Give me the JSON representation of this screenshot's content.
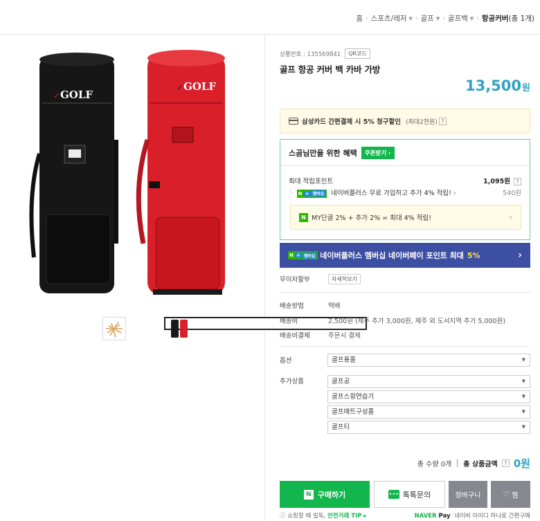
{
  "breadcrumb": {
    "items": [
      {
        "label": "홈",
        "dropdown": false
      },
      {
        "label": "스포츠/레저",
        "dropdown": true
      },
      {
        "label": "골프",
        "dropdown": true
      },
      {
        "label": "골프백",
        "dropdown": true
      }
    ],
    "current": "항공커버",
    "count": "(총 1개)"
  },
  "gallery": {
    "bag_logo_text": "GOLF",
    "bag_colors": {
      "black": "#1a1a1a",
      "red": "#d9202a"
    }
  },
  "product": {
    "number_label": "상품번호 : 135569841",
    "qr_label": "QR코드",
    "title": "골프 항공 커버 백 카바 가방",
    "price": "13,500",
    "price_unit": "원"
  },
  "card_promo": {
    "text_bold": "삼성카드 간편결제 시 5% 청구할인",
    "text_sub": "(최대2천원)",
    "help": "?"
  },
  "benefit": {
    "header": "스곰님만을 위한 혜택",
    "coupon_label": "쿠폰받기",
    "points_label": "최대 적립포인트",
    "points_value": "1,095원",
    "help": "?",
    "nplus_text": "네이버플러스 무료 가입하고 추가 4% 적립!",
    "nplus_badge_n": "N",
    "nplus_badge_plus": "+",
    "nplus_badge_mb": "멤버십",
    "nplus_value": "540원",
    "my_text": "MY단골 2% + 추가 2% = 최대 4% 적립!",
    "my_icon": "N"
  },
  "membership_banner": {
    "text": "네이버플러스 멤버십 네이버페이 포인트 최대",
    "pct": "5%"
  },
  "installment": {
    "label": "무이자할부",
    "button": "자세히보기"
  },
  "shipping": {
    "rows": [
      {
        "label": "배송방법",
        "value": "택배"
      },
      {
        "label": "배송비",
        "value": "2,500원 (제주 추가 3,000원, 제주 외 도서지역 추가 5,000원)"
      },
      {
        "label": "배송비결제",
        "value": "주문시 결제"
      }
    ]
  },
  "options": {
    "label": "옵션",
    "selected": "골프용품"
  },
  "addons": {
    "label": "추가상품",
    "selects": [
      "골프공",
      "골프스윙연습기",
      "골프매트구성품",
      "골프티"
    ]
  },
  "total": {
    "qty_label": "총 수량 0개",
    "amount_label": "총 상품금액",
    "help": "?",
    "amount": "0원"
  },
  "buttons": {
    "buy": "구매하기",
    "talk": "톡톡문의",
    "cart": "장바구니",
    "zzim": "찜"
  },
  "footer": {
    "left_prefix": "쇼핑할 때 필독,",
    "left_safe": "안전거래 TIP",
    "right_brand": "NAVER",
    "right_pay": "Pay",
    "right_text": "네이버 아이디 하나로 간편구매"
  },
  "colors": {
    "accent_price": "#31a2c6",
    "naver_green": "#12b64c",
    "benefit_border": "#6bc7ae",
    "banner_navy": "#3d4fa3"
  }
}
